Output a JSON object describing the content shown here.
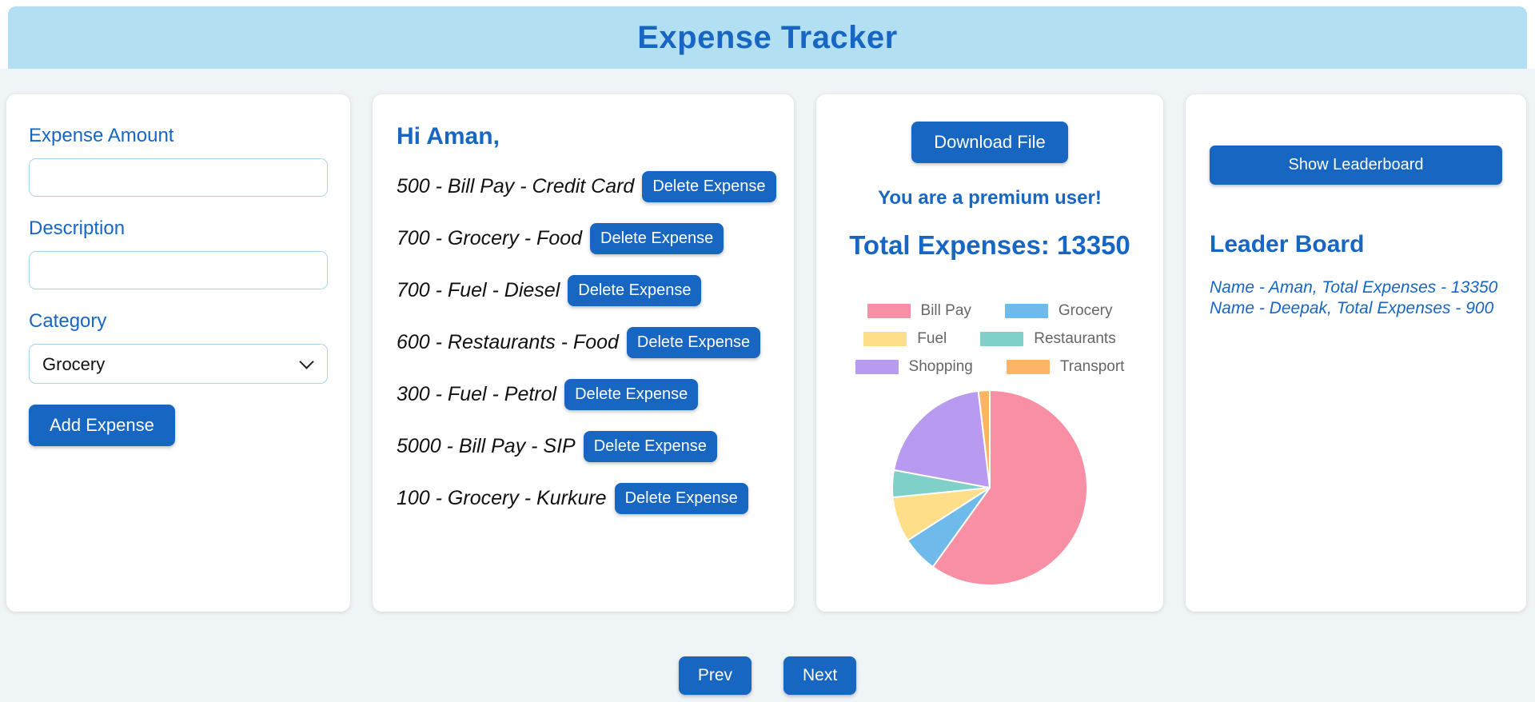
{
  "app": {
    "title": "Expense Tracker"
  },
  "palette": {
    "primary_button": "#1766C1",
    "blue_text": "#1766C4",
    "header_bg": "#B2DFF2",
    "page_bg": "#EFF4F6"
  },
  "form": {
    "amount_label": "Expense Amount",
    "amount_value": "",
    "description_label": "Description",
    "description_value": "",
    "category_label": "Category",
    "category_selected": "Grocery",
    "add_button": "Add Expense"
  },
  "expenses": {
    "greeting": "Hi Aman,",
    "delete_button": "Delete Expense",
    "items": [
      "500 - Bill Pay - Credit Card",
      "700 - Grocery - Food",
      "700 - Fuel - Diesel",
      "600 - Restaurants - Food",
      "300 - Fuel - Petrol",
      "5000 - Bill Pay - SIP",
      "100 - Grocery - Kurkure"
    ]
  },
  "summary": {
    "download_button": "Download File",
    "premium_text": "You are a premium user!",
    "total_text": "Total Expenses: 13350"
  },
  "chart_data": {
    "type": "pie",
    "title": "",
    "categories": [
      "Bill Pay",
      "Grocery",
      "Fuel",
      "Restaurants",
      "Shopping",
      "Transport"
    ],
    "values": [
      8000,
      800,
      1000,
      600,
      2700,
      250
    ],
    "total": 13350,
    "colors": [
      "#F98FA4",
      "#6EBAEB",
      "#FFDE8A",
      "#7ED0C8",
      "#B89BF0",
      "#FFB366"
    ],
    "legend_position": "top",
    "start_angle_deg": 0,
    "direction": "clockwise"
  },
  "leaderboard": {
    "show_button": "Show Leaderboard",
    "heading": "Leader Board",
    "entries": [
      "Name - Aman, Total Expenses - 13350",
      "Name - Deepak, Total Expenses - 900"
    ]
  },
  "pagination": {
    "prev": "Prev",
    "next": "Next"
  }
}
